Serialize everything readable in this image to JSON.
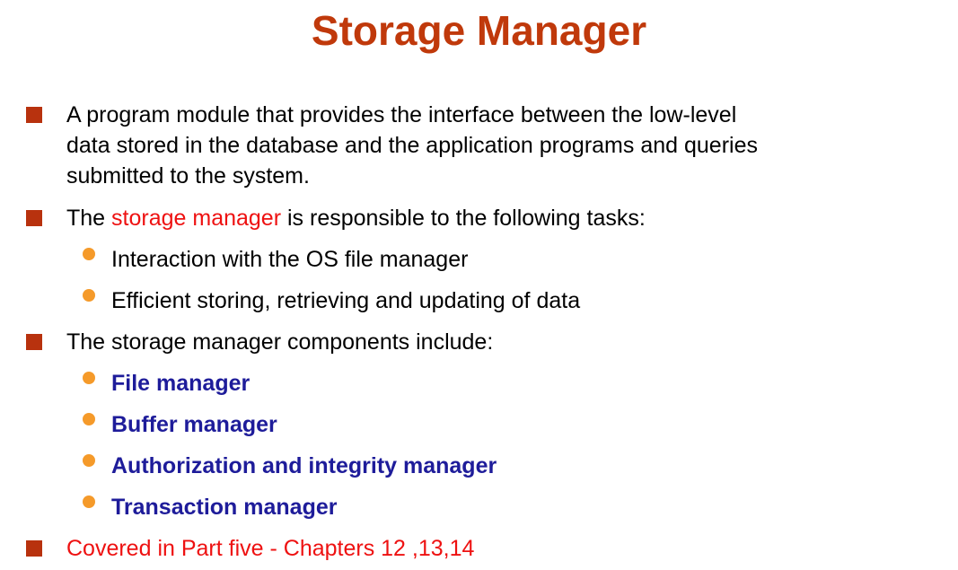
{
  "title": "Storage Manager",
  "colors": {
    "title": "#c0390b",
    "square_bullet": "#b8320e",
    "round_bullet": "#f59a2a",
    "highlight_red": "#ee1111",
    "component_blue": "#1e1c9a"
  },
  "bullets": {
    "b1": {
      "line1": "A program module that provides the interface between the low-level",
      "line2": "data stored in the database and the application programs and queries",
      "line3": "submitted to the system."
    },
    "b2": {
      "prefix": "The ",
      "highlight": "storage manager",
      "suffix": " is responsible to the following tasks:",
      "sub": [
        "Interaction with the OS file manager",
        "Efficient storing, retrieving and updating of data"
      ]
    },
    "b3": {
      "text": "The storage manager components include:",
      "sub": [
        "File manager",
        "Buffer manager",
        "Authorization and integrity manager",
        "Transaction manager"
      ]
    },
    "b4": {
      "text": "Covered in Part five - Chapters 12 ,13,14"
    }
  }
}
